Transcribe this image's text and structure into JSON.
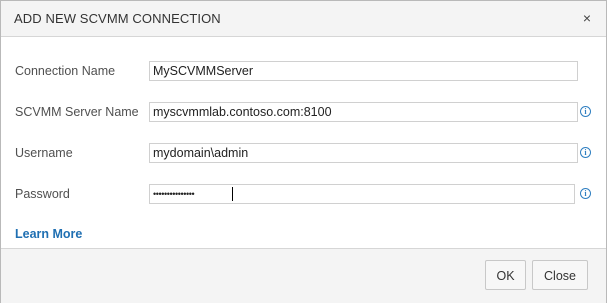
{
  "dialog": {
    "title": "ADD NEW SCVMM CONNECTION",
    "close_glyph": "×"
  },
  "form": {
    "connection_name": {
      "label": "Connection Name",
      "value": "MySCVMMServer"
    },
    "server_name": {
      "label": "SCVMM Server Name",
      "value": "myscvmmlab.contoso.com:8100",
      "info_icon": "info-icon"
    },
    "username": {
      "label": "Username",
      "value": "mydomain\\admin",
      "info_icon": "info-icon"
    },
    "password": {
      "label": "Password",
      "masked_value": "•••••••••••••••",
      "info_icon": "info-icon"
    }
  },
  "learn_more": "Learn More",
  "buttons": {
    "ok": "OK",
    "close": "Close"
  },
  "colors": {
    "accent": "#1f6fb2",
    "info": "#2f7fc1"
  }
}
